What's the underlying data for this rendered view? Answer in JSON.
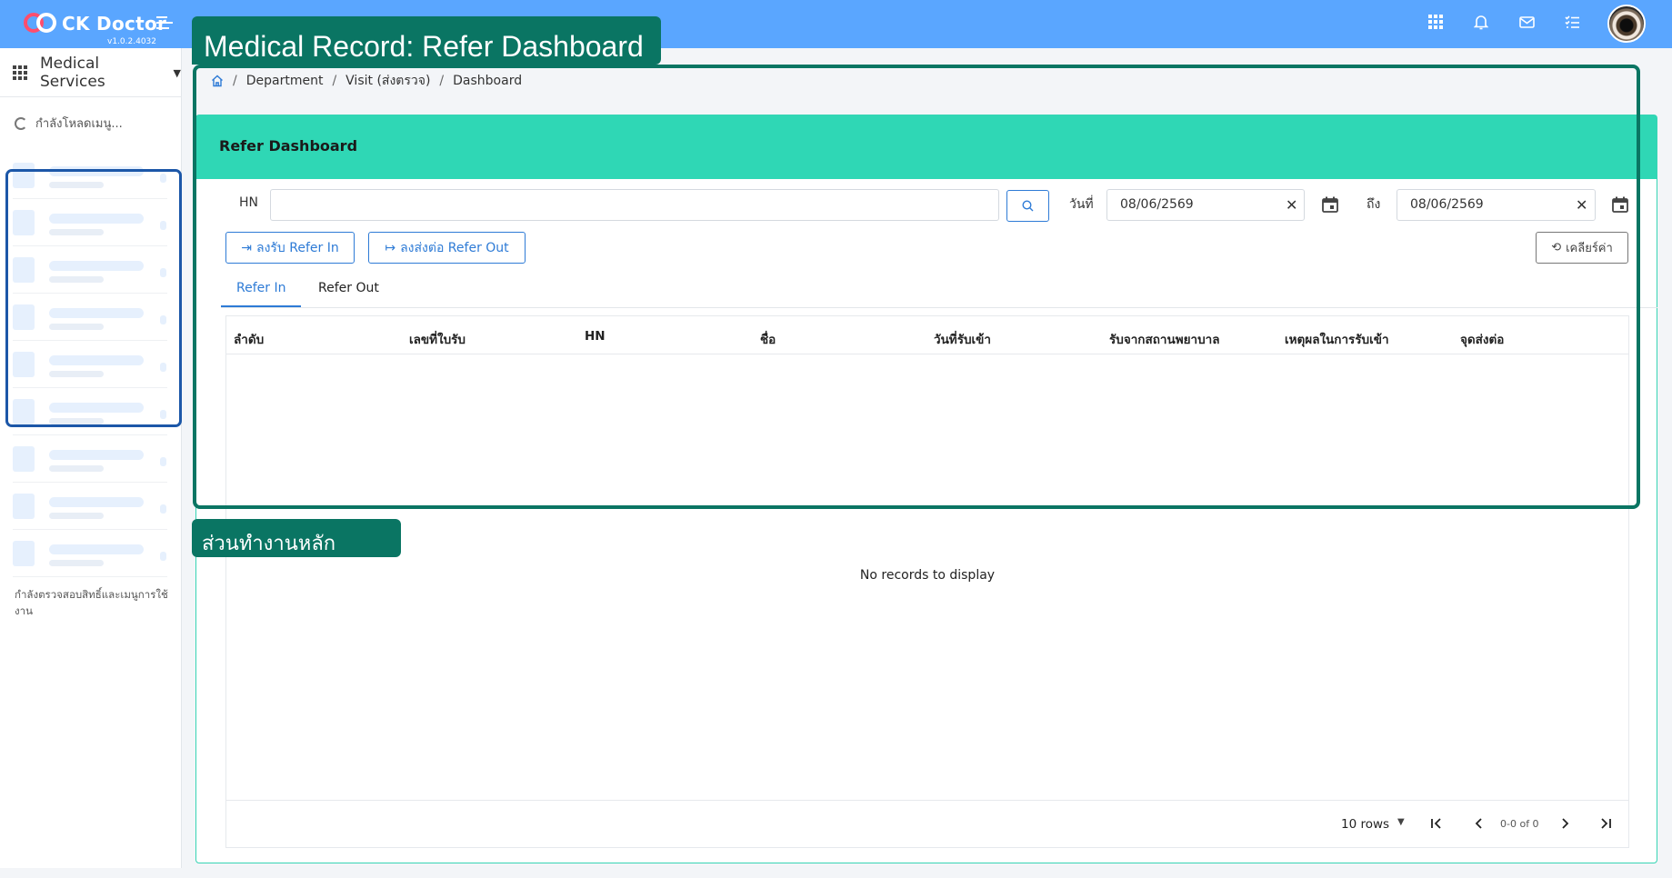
{
  "app": {
    "name": "CK Doctor",
    "version": "v1.0.2.4032"
  },
  "header": {
    "icons": [
      "apps-grid-icon",
      "bell-icon",
      "mail-icon",
      "tasks-icon"
    ],
    "accent_color": "#5aa6ff"
  },
  "sidebar": {
    "service_label": "Medical Services",
    "loading_text": "กำลังโหลดเมนู...",
    "checking_text": "กำลังตรวจสอบสิทธิ์และเมนูการใช้งาน"
  },
  "breadcrumb": [
    "Department",
    "Visit (ส่งตรวจ)",
    "Dashboard"
  ],
  "page": {
    "title": "Refer Dashboard",
    "header_color": "#2fd7b5"
  },
  "filters": {
    "hn_label": "HN",
    "hn_value": "",
    "date_label": "วันที่",
    "date_from": "08/06/2569",
    "to_label": "ถึง",
    "date_to": "08/06/2569"
  },
  "actions": {
    "refer_in": "ลงรับ Refer In",
    "refer_out": "ลงส่งต่อ Refer Out",
    "reset": "เคลียร์ค่า"
  },
  "tabs": [
    {
      "label": "Refer In",
      "active": true
    },
    {
      "label": "Refer Out",
      "active": false
    }
  ],
  "table": {
    "columns": [
      "ลำดับ",
      "เลขที่ใบรับ",
      "HN",
      "ชื่อ",
      "วันที่รับเข้า",
      "รับจากสถานพยาบาล",
      "เหตุผลในการรับเข้า",
      "จุดส่งต่อ"
    ],
    "rows": [],
    "empty_text": "No records to display"
  },
  "pagination": {
    "rows_per_page": "10 rows",
    "info": "0-0 of 0"
  },
  "annotations": {
    "main_title": "Medical Record: Refer Dashboard",
    "workspace_label": "ส่วนทำงานหลัก",
    "color": "#0a7563"
  }
}
